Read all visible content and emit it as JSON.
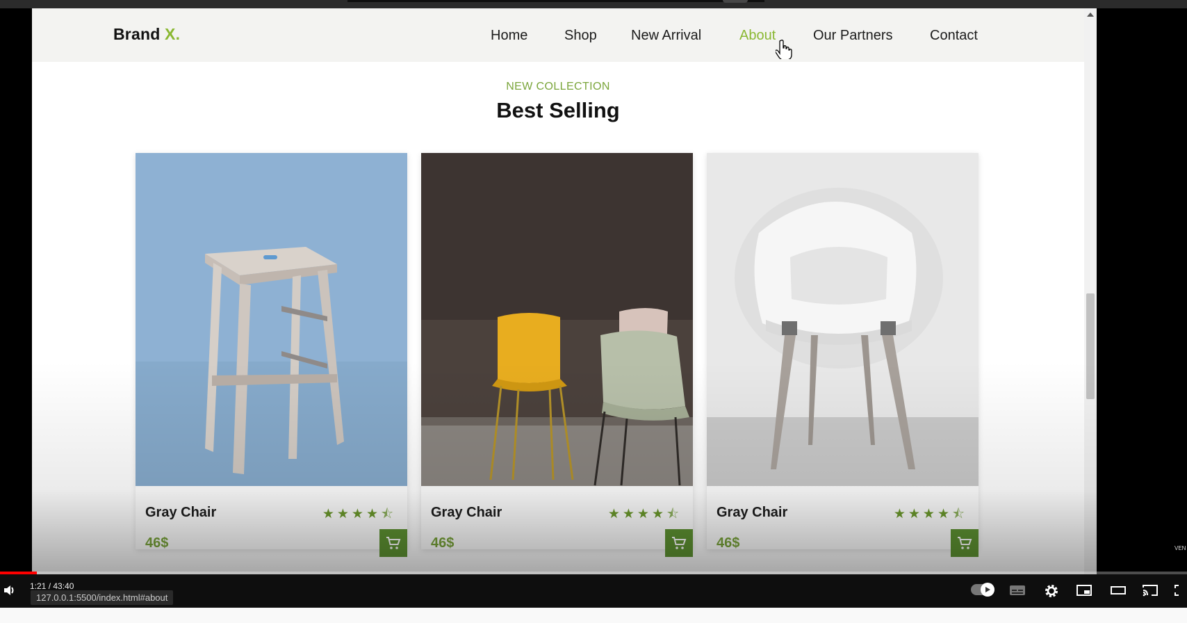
{
  "navbar": {
    "brand": "Brand",
    "brand_accent": "X.",
    "items": [
      {
        "label": "Home"
      },
      {
        "label": "Shop"
      },
      {
        "label": "New Arrival"
      },
      {
        "label": "About"
      },
      {
        "label": "Our Partners"
      },
      {
        "label": "Contact"
      }
    ],
    "active": "About"
  },
  "section": {
    "eyebrow": "NEW COLLECTION",
    "title": "Best Selling"
  },
  "products": [
    {
      "name": "Gray Chair",
      "price": "46$",
      "rating": 4.5,
      "image": "wooden-stool-photo"
    },
    {
      "name": "Gray Chair",
      "price": "46$",
      "rating": 4.5,
      "image": "yellow-chairs-photo"
    },
    {
      "name": "Gray Chair",
      "price": "46$",
      "rating": 4.5,
      "image": "white-chair-photo"
    }
  ],
  "player": {
    "time": "1:21 / 43:40",
    "progress": 0.031,
    "status_url": "127.0.0.1:5500/index.html#about"
  },
  "colors": {
    "accent": "#8ab832",
    "cart": "#5f9432",
    "nav_bg": "#f3f3f1"
  }
}
